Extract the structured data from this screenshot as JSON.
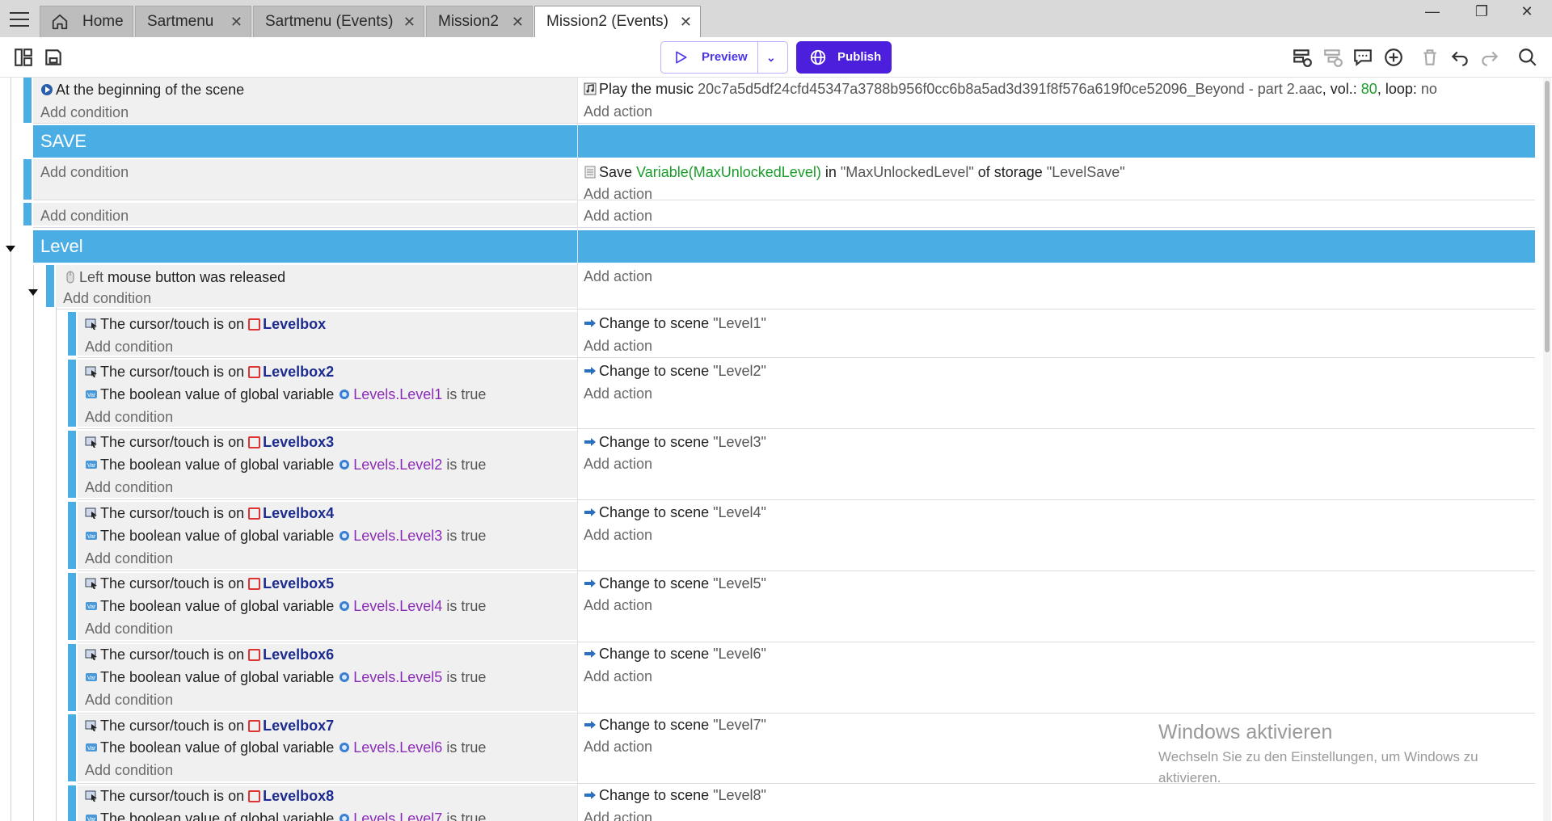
{
  "tabs": [
    {
      "label": "Home"
    },
    {
      "label": "Sartmenu"
    },
    {
      "label": "Sartmenu (Events)"
    },
    {
      "label": "Mission2"
    },
    {
      "label": "Mission2 (Events)"
    }
  ],
  "toolbar": {
    "preview_label": "Preview",
    "publish_label": "Publish"
  },
  "events": {
    "start_cond": "At the beginning of the scene",
    "add_condition": "Add condition",
    "add_action": "Add action",
    "music_action_prefix": "Play the music",
    "music_file": "20c7a5d5df24cfd45347a3788b956f0cc6b8a5ad3d391f8f576a619f0ce52096_Beyond - part 2.aac",
    "music_vol_label": ", vol.:",
    "music_vol": "80",
    "music_loop_label": ", loop:",
    "music_loop": "no",
    "group_save": "SAVE",
    "save_prefix": "Save",
    "save_var": "Variable(MaxUnlockedLevel)",
    "save_in": "in",
    "save_key": "\"MaxUnlockedLevel\"",
    "save_of": "of storage",
    "save_storage": "\"LevelSave\"",
    "group_level": "Level",
    "mouse_left": "Left",
    "mouse_cond": "mouse button was released",
    "cursor_on": "The cursor/touch is on",
    "bool_var": "The boolean value of global variable",
    "is_true": "is true",
    "change_scene": "Change to scene",
    "levels": [
      {
        "obj": "Levelbox",
        "var": "",
        "scene": "\"Level1\""
      },
      {
        "obj": "Levelbox2",
        "var": "Levels.Level1",
        "scene": "\"Level2\""
      },
      {
        "obj": "Levelbox3",
        "var": "Levels.Level2",
        "scene": "\"Level3\""
      },
      {
        "obj": "Levelbox4",
        "var": "Levels.Level3",
        "scene": "\"Level4\""
      },
      {
        "obj": "Levelbox5",
        "var": "Levels.Level4",
        "scene": "\"Level5\""
      },
      {
        "obj": "Levelbox6",
        "var": "Levels.Level5",
        "scene": "\"Level6\""
      },
      {
        "obj": "Levelbox7",
        "var": "Levels.Level6",
        "scene": "\"Level7\""
      },
      {
        "obj": "Levelbox8",
        "var": "Levels.Level7",
        "scene": "\"Level8\""
      }
    ]
  },
  "watermark": {
    "title": "Windows aktivieren",
    "text": "Wechseln Sie zu den Einstellungen, um Windows zu aktivieren."
  },
  "colors": {
    "accent": "#4aade3",
    "publish": "#4b1fdb",
    "object": "#1c2b8e",
    "variable": "#8b2cb8",
    "expression": "#1a9c2a"
  }
}
